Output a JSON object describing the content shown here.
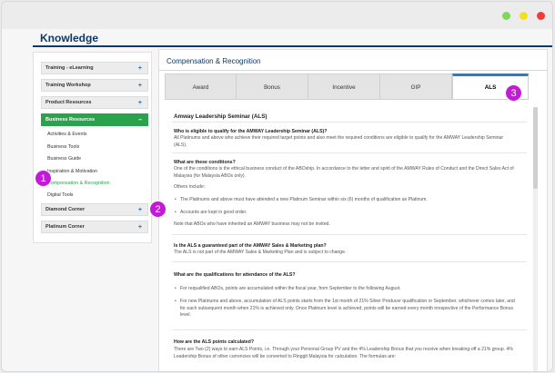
{
  "window": {
    "controls": [
      {
        "name": "maximize",
        "color": "#7ed957"
      },
      {
        "name": "minimize",
        "color": "#f5e11b"
      },
      {
        "name": "close",
        "color": "#f33a3a"
      }
    ]
  },
  "page": {
    "title": "Knowledge"
  },
  "sidebar": {
    "top_items": [
      {
        "label": "Training - eLearning",
        "icon": "plus-icon",
        "symbol": "+"
      },
      {
        "label": "Training Workshop",
        "icon": "plus-icon",
        "symbol": "+"
      },
      {
        "label": "Product Resources",
        "icon": "plus-icon",
        "symbol": "+"
      },
      {
        "label": "Business Resources",
        "icon": "minus-icon",
        "symbol": "–",
        "active": true
      }
    ],
    "sub_items": [
      "Activities & Events",
      "Business Tools",
      "Business Guide",
      "Inspiration & Motivation",
      "Compensation & Recognition",
      "Digital Tools"
    ],
    "bottom_items": [
      {
        "label": "Diamond Corner",
        "icon": "plus-icon",
        "symbol": "+"
      },
      {
        "label": "Platinum Corner",
        "icon": "plus-icon",
        "symbol": "+"
      }
    ]
  },
  "main": {
    "title": "Compensation & Recognition",
    "tabs": [
      "Award",
      "Bonus",
      "Incentive",
      "GIP",
      "ALS"
    ],
    "active_tab": "ALS",
    "section_title": "Amway Leadership Seminar (ALS)",
    "faq": {
      "q1": "Who is eligible to qualify for the AMWAY Leadership Seminar (ALS)?",
      "a1": "All Platinums and above who achieve their required target points and also meet the required conditions are eligible to qualify for the AMWAY Leadership Seminar (ALS).",
      "q2": "What are these conditions?",
      "a2": "One of the conditions is the ethical business conduct of the ABOship. In accordance to the letter and spirit of the AMWAY Rules of Conduct and the Direct Sales Act of Malaysia (for Malaysia ABOs only).",
      "a2_others": "Others include:",
      "a2_bullets": [
        "The Platinums and above must have attended a new Platinum Seminar within six (6) months of qualification as Platinum.",
        "Accounts are kept in good order."
      ],
      "a2_note": "Note that ABOs who have inherited an AMWAY business may not be invited.",
      "q3": "Is the ALS a guaranteed part of the AMWAY Sales & Marketing plan?",
      "a3": "The ALS is not part of the AMWAY Sales & Marketing Plan and is subject to change.",
      "q4": "What are the qualifications for attendance of the ALS?",
      "a4_bullets": [
        "For requalified ABOs, points are accumulated within the fiscal year, from September to the following August.",
        "For new Platinums and above, accumulation of ALS points starts from the 1st month of 21% Silver Producer qualification or September, whichever comes later, and for each subsequent month when 21% is achieved only. Once Platinum level is achieved, points will be earned every month irrespective of the Performance Bonus level."
      ],
      "q5": "How are the ALS points calculated?",
      "a5": "There are Two (2) ways to earn ALS Points, i.e. Through your Personal Group PV and the 4% Leadership Bonus that you receive when breaking-off a 21% group. 4% Leadership Bonus of other currencies will be converted to Ringgit Malaysia for calculation. The formulas are:"
    }
  },
  "callouts": [
    "1",
    "2",
    "3"
  ],
  "colors": {
    "brand_navy": "#0d3a66",
    "active_green": "#2ba24c",
    "tab_accent": "#1f7fce",
    "callout": "#c21bd6"
  }
}
